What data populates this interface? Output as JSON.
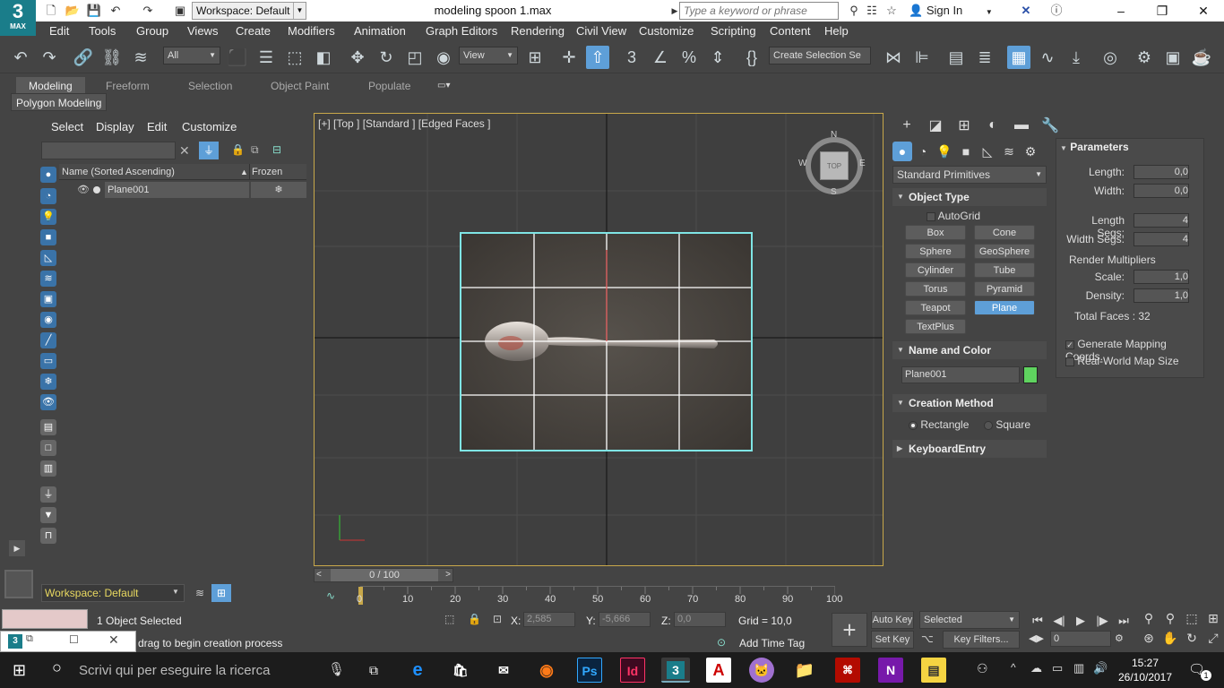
{
  "app": {
    "logo_num": "3",
    "logo_label": "MAX",
    "title": "modeling spoon 1.max",
    "workspace": "Workspace: Default"
  },
  "search": {
    "placeholder": "Type a keyword or phrase"
  },
  "signin": "Sign In",
  "menus": [
    "Edit",
    "Tools",
    "Group",
    "Views",
    "Create",
    "Modifiers",
    "Animation",
    "Graph Editors",
    "Rendering",
    "Civil View",
    "Customize",
    "Scripting",
    "Content",
    "Help"
  ],
  "toolbar": {
    "filter": "All",
    "refcoord": "View",
    "selset": "Create Selection Se"
  },
  "ribbon": {
    "tabs": [
      "Modeling",
      "Freeform",
      "Selection",
      "Object Paint",
      "Populate"
    ],
    "panel": "Polygon Modeling"
  },
  "scene_explorer": {
    "menus": [
      "Select",
      "Display",
      "Edit",
      "Customize"
    ],
    "col_name": "Name (Sorted Ascending)",
    "col_frozen": "Frozen",
    "sort_arrow": "▲",
    "rows": [
      {
        "name": "Plane001"
      }
    ],
    "workspace": "Workspace: Default"
  },
  "viewport": {
    "label": "[+] [Top ] [Standard ] [Edged Faces ]",
    "cube": {
      "n": "N",
      "s": "S",
      "e": "E",
      "w": "W",
      "face": "TOP"
    }
  },
  "command_panel": {
    "category": "Standard Primitives",
    "object_type": {
      "title": "Object Type",
      "autogrid": "AutoGrid",
      "buttons": [
        "Box",
        "Cone",
        "Sphere",
        "GeoSphere",
        "Cylinder",
        "Tube",
        "Torus",
        "Pyramid",
        "Teapot",
        "Plane",
        "TextPlus"
      ],
      "active": "Plane"
    },
    "name_color": {
      "title": "Name and Color",
      "name": "Plane001",
      "color": "#5fd35f"
    },
    "creation": {
      "title": "Creation Method",
      "opt1": "Rectangle",
      "opt2": "Square"
    },
    "keyboard": {
      "title": "KeyboardEntry"
    },
    "parameters": {
      "title": "Parameters",
      "length_label": "Length:",
      "length": "0,0",
      "width_label": "Width:",
      "width": "0,0",
      "lsegs_label": "Length Segs:",
      "lsegs": "4",
      "wsegs_label": "Width Segs:",
      "wsegs": "4",
      "rm_title": "Render Multipliers",
      "scale_label": "Scale:",
      "scale": "1,0",
      "density_label": "Density:",
      "density": "1,0",
      "total_faces": "Total Faces : 32",
      "gen_map": "Generate Mapping Coords.",
      "real_world": "Real-World Map Size"
    }
  },
  "timeline": {
    "frame": "0 / 100",
    "ticks": [
      "0",
      "10",
      "20",
      "30",
      "40",
      "50",
      "60",
      "70",
      "80",
      "90",
      "100"
    ]
  },
  "status": {
    "selected": "1 Object Selected",
    "prompt": "drag to begin creation process",
    "x_label": "X:",
    "x": "2,585",
    "y_label": "Y:",
    "y": "-5,666",
    "z_label": "Z:",
    "z": "0,0",
    "grid": "Grid = 10,0",
    "add_time_tag": "Add Time Tag",
    "auto_key": "Auto Key",
    "set_key": "Set Key",
    "key_mode": "Selected",
    "key_filters": "Key Filters...",
    "frame_field": "0"
  },
  "taskbar": {
    "search": "Scrivi qui per eseguire la ricerca",
    "time": "15:27",
    "date": "26/10/2017",
    "notif": "1"
  }
}
